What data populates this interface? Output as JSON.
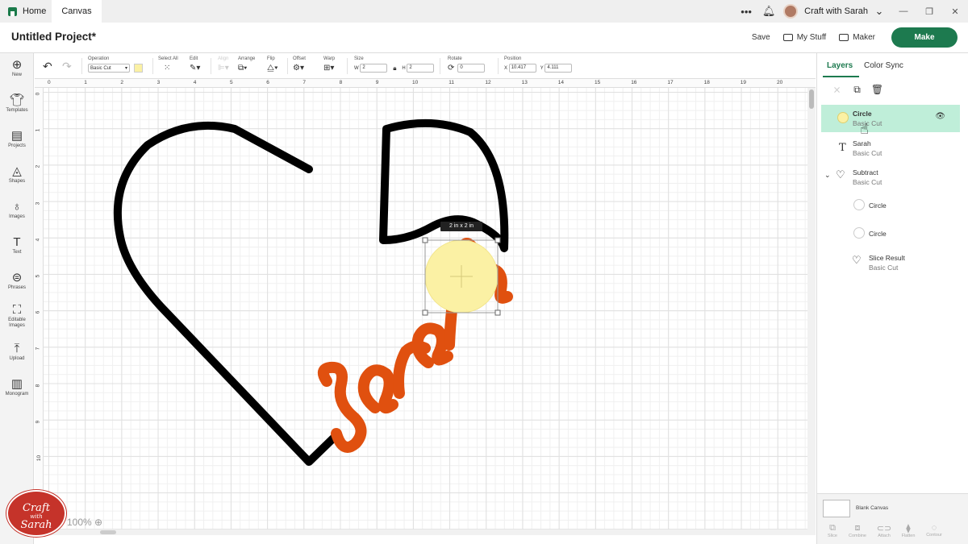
{
  "tabs": {
    "home": "Home",
    "canvas": "Canvas"
  },
  "account": {
    "name": "Craft with Sarah"
  },
  "header": {
    "title": "Untitled Project*",
    "save": "Save",
    "my_stuff": "My Stuff",
    "maker": "Maker",
    "make": "Make"
  },
  "sidebar": [
    {
      "icon": "new-icon",
      "label": "New"
    },
    {
      "icon": "templates-icon",
      "label": "Templates"
    },
    {
      "icon": "projects-icon",
      "label": "Projects"
    },
    {
      "icon": "shapes-icon",
      "label": "Shapes"
    },
    {
      "icon": "images-icon",
      "label": "Images"
    },
    {
      "icon": "text-icon",
      "label": "Text"
    },
    {
      "icon": "phrases-icon",
      "label": "Phrases"
    },
    {
      "icon": "editable-images-icon",
      "label": "Editable Images"
    },
    {
      "icon": "upload-icon",
      "label": "Upload"
    },
    {
      "icon": "monogram-icon",
      "label": "Monogram"
    }
  ],
  "toolbar": {
    "operation_label": "Operation",
    "operation_value": "Basic Cut",
    "operation_color": "#fbf1a4",
    "select_all": "Select All",
    "edit": "Edit",
    "align": "Align",
    "arrange": "Arrange",
    "flip": "Flip",
    "offset": "Offset",
    "warp": "Warp",
    "size": "Size",
    "w_label": "W",
    "w_value": "2",
    "h_label": "H",
    "h_value": "2",
    "rotate": "Rotate",
    "rotate_value": "0",
    "position": "Position",
    "x_label": "X",
    "x_value": "10.417",
    "y_label": "Y",
    "y_value": "4.111"
  },
  "rulers": {
    "top": [
      "0",
      "1",
      "2",
      "3",
      "4",
      "5",
      "6",
      "7",
      "8",
      "9",
      "10",
      "11",
      "12",
      "13",
      "14",
      "15",
      "16",
      "17",
      "18",
      "19",
      "20"
    ],
    "left": [
      "0",
      "1",
      "2",
      "3",
      "4",
      "5",
      "6",
      "7",
      "8",
      "9",
      "10"
    ]
  },
  "canvas": {
    "size_tooltip": "2 in x 2 in",
    "zoom": "100%",
    "text_layer": "Sarah",
    "colors": {
      "heart": "#000000",
      "text": "#e0500f",
      "circle": "#fbf1a4"
    }
  },
  "logo": {
    "line1": "Craft",
    "line2": "with",
    "line3": "Sarah"
  },
  "panel": {
    "tab_layers": "Layers",
    "tab_color_sync": "Color Sync",
    "layers": [
      {
        "name": "Circle",
        "op": "Basic Cut",
        "icon": "circle-icon",
        "selected": true
      },
      {
        "name": "Sarah",
        "op": "Basic Cut",
        "icon": "text-icon"
      },
      {
        "name": "Subtract",
        "op": "Basic Cut",
        "icon": "heart-icon"
      },
      {
        "name": "Circle",
        "op": "",
        "icon": "circle-icon"
      },
      {
        "name": "Circle",
        "op": "",
        "icon": "circle-icon"
      },
      {
        "name": "Slice Result",
        "op": "Basic Cut",
        "icon": "heart-icon"
      }
    ],
    "blank_canvas": "Blank Canvas",
    "actions": [
      "Slice",
      "Combine",
      "Attach",
      "Flatten",
      "Contour"
    ]
  }
}
